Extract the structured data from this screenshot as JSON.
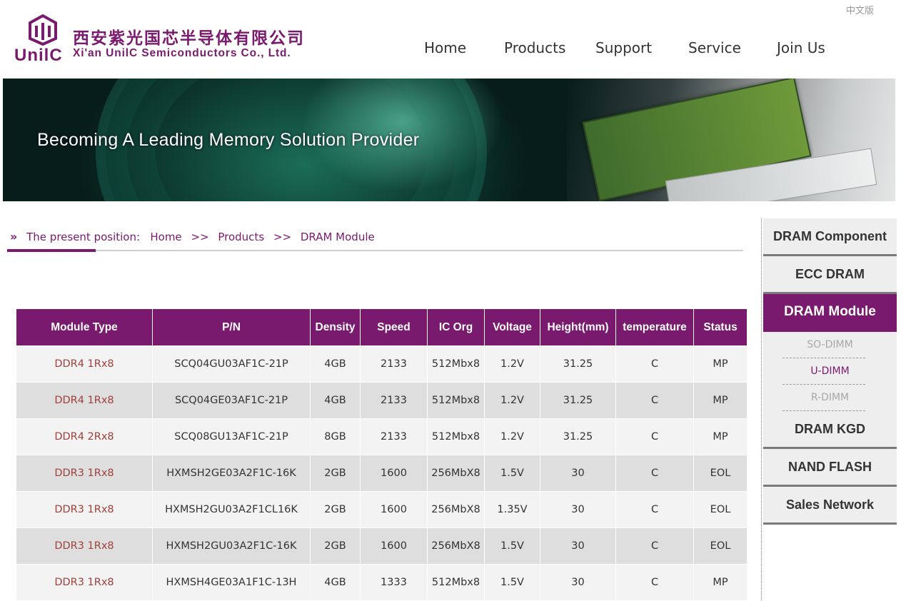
{
  "header": {
    "lang_switch": "中文版",
    "logo": {
      "word": "UnilC",
      "cn": "西安紫光国芯半导体有限公司",
      "en": "Xi'an UnilC Semiconductors Co., Ltd."
    },
    "nav": [
      {
        "label": "Home"
      },
      {
        "label": "Products"
      },
      {
        "label": "Support"
      },
      {
        "label": "Service"
      },
      {
        "label": "Join Us"
      }
    ]
  },
  "banner": {
    "tagline": "Becoming A Leading Memory Solution Provider"
  },
  "breadcrumb": {
    "prefix": "The present position:",
    "items": [
      "Home",
      "Products",
      "DRAM Module"
    ],
    "separator": ">>"
  },
  "table": {
    "headers": [
      "Module Type",
      "P/N",
      "Density",
      "Speed",
      "IC Org",
      "Voltage",
      "Height(mm)",
      "temperature",
      "Status"
    ],
    "rows": [
      [
        "DDR4 1Rx8",
        "SCQ04GU03AF1C-21P",
        "4GB",
        "2133",
        "512Mbx8",
        "1.2V",
        "31.25",
        "C",
        "MP"
      ],
      [
        "DDR4 1Rx8",
        "SCQ04GE03AF1C-21P",
        "4GB",
        "2133",
        "512Mbx8",
        "1.2V",
        "31.25",
        "C",
        "MP"
      ],
      [
        "DDR4 2Rx8",
        "SCQ08GU13AF1C-21P",
        "8GB",
        "2133",
        "512Mbx8",
        "1.2V",
        "31.25",
        "C",
        "MP"
      ],
      [
        "DDR3 1Rx8",
        "HXMSH2GE03A2F1C-16K",
        "2GB",
        "1600",
        "256MbX8",
        "1.5V",
        "30",
        "C",
        "EOL"
      ],
      [
        "DDR3 1Rx8",
        "HXMSH2GU03A2F1CL16K",
        "2GB",
        "1600",
        "256MbX8",
        "1.35V",
        "30",
        "C",
        "EOL"
      ],
      [
        "DDR3 1Rx8",
        "HXMSH2GU03A2F1C-16K",
        "2GB",
        "1600",
        "256MbX8",
        "1.5V",
        "30",
        "C",
        "EOL"
      ],
      [
        "DDR3 1Rx8",
        "HXMSH4GE03A1F1C-13H",
        "4GB",
        "1333",
        "512Mbx8",
        "1.5V",
        "30",
        "C",
        "MP"
      ]
    ]
  },
  "sidebar": {
    "items_top": [
      "DRAM Component",
      "ECC DRAM"
    ],
    "active": "DRAM Module",
    "sub_items": [
      {
        "label": "SO-DIMM",
        "active": false
      },
      {
        "label": "U-DIMM",
        "active": true
      },
      {
        "label": "R-DIMM",
        "active": false
      }
    ],
    "items_bottom": [
      "DRAM KGD",
      "NAND FLASH",
      "Sales Network"
    ]
  },
  "colors": {
    "brand": "#7a1a6e",
    "row_light": "#f3f3f3",
    "row_dark": "#dedede",
    "type_text": "#a0403a"
  }
}
